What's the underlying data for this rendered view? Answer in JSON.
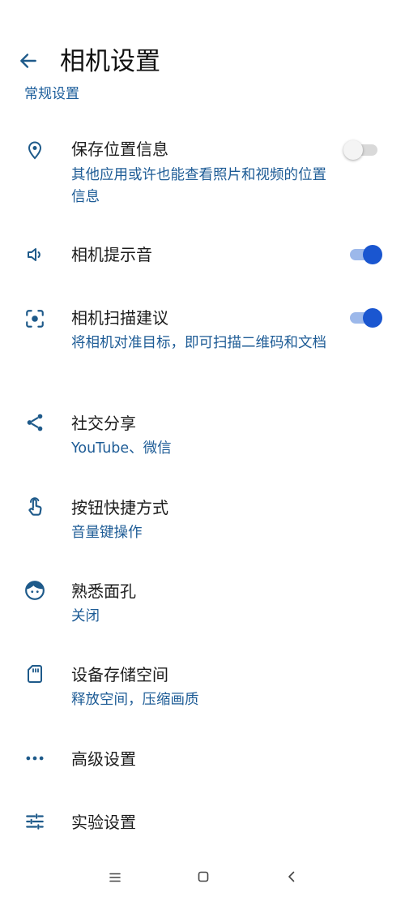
{
  "header": {
    "title": "相机设置",
    "back_icon": "arrow-left-icon"
  },
  "section": {
    "label": "常规设置"
  },
  "settings": [
    {
      "label": "保存位置信息",
      "sub": "其他应用或许也能查看照片和视频的位置信息",
      "icon": "location-pin-icon",
      "toggle": "off"
    },
    {
      "label": "相机提示音",
      "icon": "speaker-icon",
      "toggle": "on"
    },
    {
      "label": "相机扫描建议",
      "sub": "将相机对准目标，即可扫描二维码和文档",
      "icon": "scan-icon",
      "toggle": "on"
    },
    {
      "label": "社交分享",
      "sub": "YouTube、微信",
      "icon": "share-icon"
    },
    {
      "label": "按钮快捷方式",
      "sub": "音量键操作",
      "icon": "touch-icon"
    },
    {
      "label": "熟悉面孔",
      "sub": "关闭",
      "icon": "face-icon"
    },
    {
      "label": "设备存储空间",
      "sub": "释放空间，压缩画质",
      "icon": "sd-card-icon"
    },
    {
      "label": "高级设置",
      "icon": "more-dots-icon"
    },
    {
      "label": "实验设置",
      "icon": "sliders-icon"
    }
  ],
  "colors": {
    "accent": "#1a56d0",
    "icon": "#1e5a8a",
    "subtext": "#1e5c96"
  },
  "navbar": {
    "icons": [
      "menu-icon",
      "home-icon",
      "back-icon"
    ]
  }
}
